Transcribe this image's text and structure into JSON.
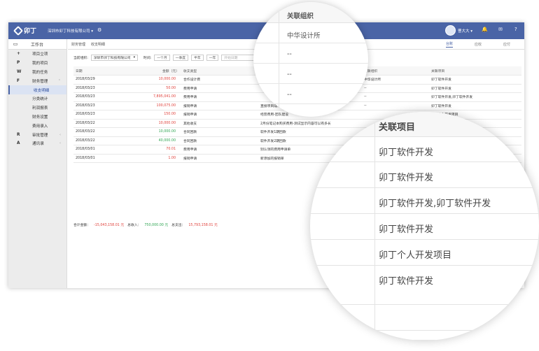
{
  "topbar": {
    "logo": "卯丁",
    "company": "深圳市卯丁科技有限公司",
    "user": "曹大大"
  },
  "sidebar": {
    "workspace": "工作台",
    "items": [
      {
        "key": "+",
        "label": "项目立项"
      },
      {
        "key": "P",
        "label": "我的项目"
      },
      {
        "key": "W",
        "label": "我的任务"
      },
      {
        "key": "F",
        "label": "财务管理",
        "chev": "⌃"
      },
      {
        "key": "",
        "label": "收支明细",
        "active": true,
        "sub": true
      },
      {
        "key": "",
        "label": "分类统计",
        "sub": true
      },
      {
        "key": "",
        "label": "利润报表",
        "sub": true
      },
      {
        "key": "",
        "label": "财务设置",
        "sub": true
      },
      {
        "key": "",
        "label": "费用录入",
        "sub": true
      },
      {
        "key": "R",
        "label": "审批管理",
        "chev": "‹"
      },
      {
        "key": "A",
        "label": "通讯录",
        "chev": "‹"
      }
    ]
  },
  "breadcrumb": {
    "a": "财务管理",
    "b": "收支明细"
  },
  "tabs": [
    "台账",
    "应收",
    "应付"
  ],
  "filter": {
    "org_label": "当前组织:",
    "org_value": "深圳市卯丁科技有限公司",
    "time_label": "时间:",
    "ranges": [
      "一个月",
      "一季度",
      "半年",
      "一年"
    ],
    "start_placeholder": "开始日期"
  },
  "table": {
    "headers": [
      "日期",
      "金额（元）",
      "收支类型",
      "",
      "关联组织",
      "关联项目"
    ],
    "rows": [
      [
        "2018/03/29",
        "10,000.00",
        "合作设计费",
        "",
        "中华设计所",
        "卯丁软件开发"
      ],
      [
        "2018/03/23",
        "50.00",
        "费用申请",
        "",
        "--",
        "卯丁软件开发"
      ],
      [
        "2018/03/23",
        "7,895,041.00",
        "费用申请",
        "",
        "--",
        "卯丁软件开发,卯丁软件开发"
      ],
      [
        "2018/03/23",
        "100,075.00",
        "报销申请",
        "直接项目成本-制图费用",
        "--",
        "卯丁软件开发"
      ],
      [
        "2018/03/23",
        "150.00",
        "报销申请",
        "经营费用-团队建设",
        "",
        "卯丁个人开发项目"
      ],
      [
        "2018/03/22",
        "10,000.00",
        "其他收支",
        "2月份笔记本购买费用-测试显示内容可以有多长",
        "",
        ""
      ],
      [
        "2018/03/22",
        "10,000.00",
        "合同回款",
        "软件开发1期回款",
        "",
        ""
      ],
      [
        "2018/03/22",
        "40,000.00",
        "合同回款",
        "软件开发2期回款",
        "",
        ""
      ],
      [
        "2018/03/01",
        "70.01",
        "费用申请",
        "别认领的费用申请单",
        "",
        ""
      ],
      [
        "2018/03/01",
        "1.00",
        "报销申请",
        "新添加的报销单",
        "",
        ""
      ]
    ],
    "amount_colors": [
      "red",
      "red",
      "red",
      "red",
      "red",
      "red",
      "green",
      "green",
      "red",
      "red"
    ]
  },
  "totals": {
    "total_label": "合计金额：",
    "total": "-15,043,158.01 元",
    "in_label": "总收入：",
    "in": "750,000.00 元",
    "out_label": "总支出：",
    "out": "15,793,158.01 元"
  },
  "zoom_small": {
    "header": "关联组织",
    "rows": [
      "中华设计所",
      "--",
      "--",
      "--"
    ]
  },
  "zoom_large": {
    "header": "关联项目",
    "rows": [
      "卯丁软件开发",
      "卯丁软件开发",
      "卯丁软件开发,卯丁软件开发",
      "卯丁软件开发",
      "卯丁个人开发项目",
      "卯丁软件开发",
      "",
      "卯丁软件开发"
    ]
  },
  "colors": {
    "brand": "#4a64a6",
    "expense": "#e0413b",
    "income": "#2fa552"
  }
}
